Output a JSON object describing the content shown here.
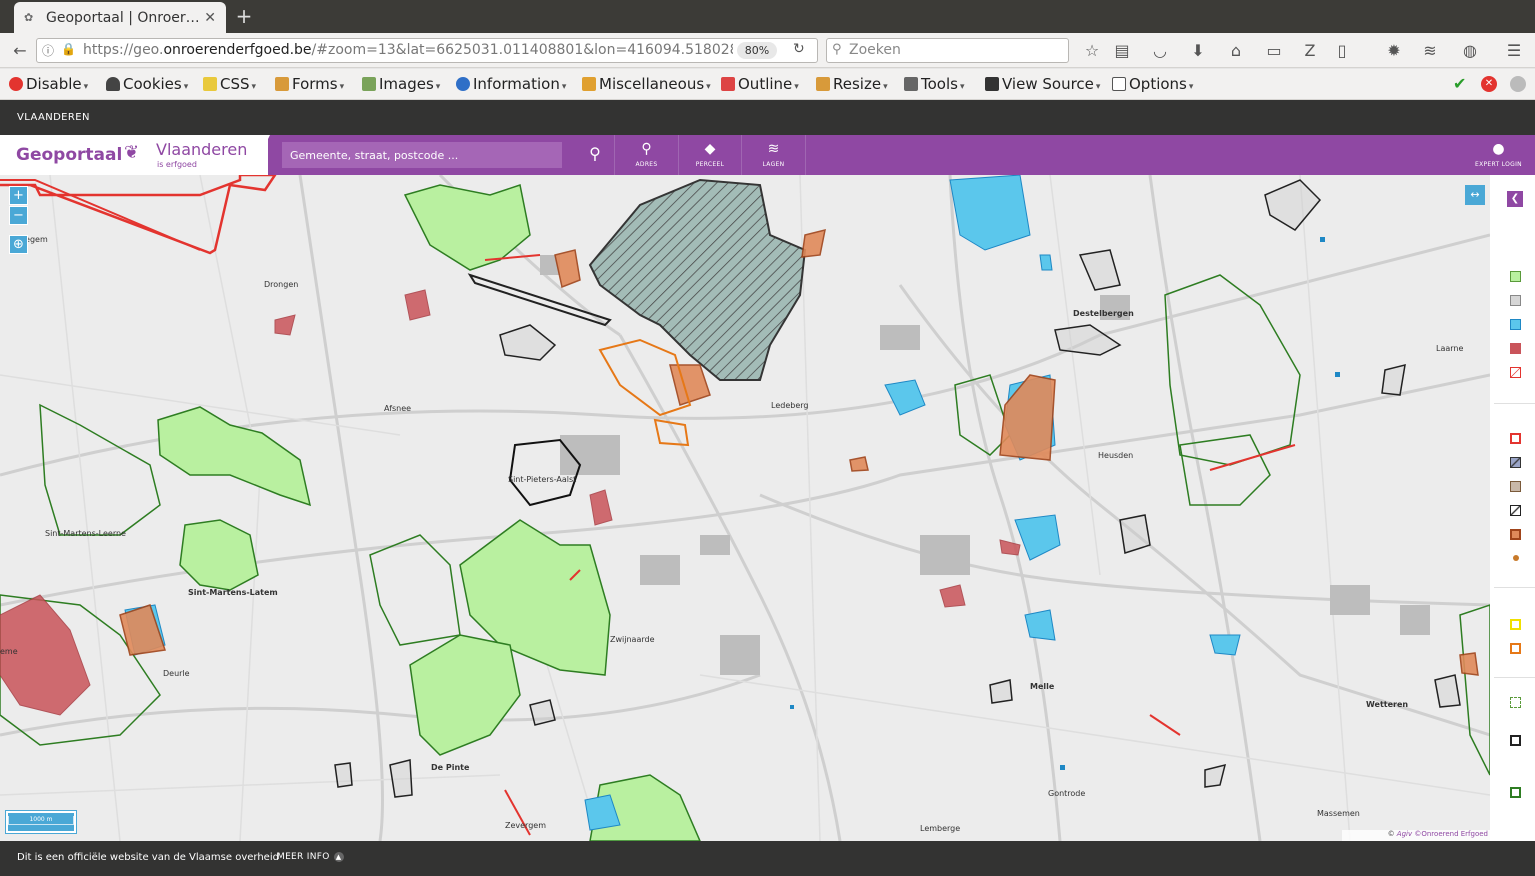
{
  "browser": {
    "tab_title": "Geoportaal | Onroer…",
    "url_prefix": "https://geo.",
    "url_domain": "onroerenderfgoed.be",
    "url_rest": "/#zoom=13&lat=6625031.011408801&lon=416094.5180285€",
    "zoom_level": "80%",
    "search_placeholder": "Zoeken"
  },
  "devtoolbar": {
    "items": [
      "Disable",
      "Cookies",
      "CSS",
      "Forms",
      "Images",
      "Information",
      "Miscellaneous",
      "Outline",
      "Resize",
      "Tools",
      "View Source",
      "Options"
    ]
  },
  "vlaanderen_bar": {
    "label": "VLAANDEREN"
  },
  "header": {
    "app_title": "Geoportaal",
    "brand_name": "Vlaanderen",
    "brand_sub": "is erfgoed",
    "search_placeholder": "Gemeente, straat, postcode ...",
    "buttons": {
      "adres": "ADRES",
      "perceel": "PERCEEL",
      "lagen": "LAGEN",
      "login": "EXPERT LOGIN"
    }
  },
  "map": {
    "place_labels": {
      "landegem": "andegem",
      "drongen": "Drongen",
      "afsnee": "Afsnee",
      "sintmartensleerne": "Sint-Martens-Leerne",
      "sintmartenslatem": "Sint-Martens-Latem",
      "eme": "eme",
      "deurle": "Deurle",
      "depinte": "De Pinte",
      "zevergem": "Zevergem",
      "zwijnaarde": "Zwijnaarde",
      "ledeberg": "Ledeberg",
      "destelbergen": "Destelbergen",
      "heusden": "Heusden",
      "laarne": "Laarne",
      "melle": "Melle",
      "gontrode": "Gontrode",
      "lemberge": "Lemberge",
      "wetteren": "Wetteren",
      "massemen": "Massemen",
      "sintpieters": "Sint-Pieters-Aalst"
    },
    "scale_label": "1000 m",
    "attribution": {
      "agiv": "Agiv",
      "copyright": "©",
      "oe": "©Onroerend Erfgoed"
    }
  },
  "footer": {
    "official": "Dit is een officiële website van de Vlaamse overheid",
    "more": "MEER INFO"
  },
  "colors": {
    "purple": "#8f48a3",
    "blue": "#4aa8d6",
    "green_fill": "#b9f0a0",
    "cyan_fill": "#5bc7ec",
    "red": "#e3342f",
    "orange": "#e67817"
  }
}
